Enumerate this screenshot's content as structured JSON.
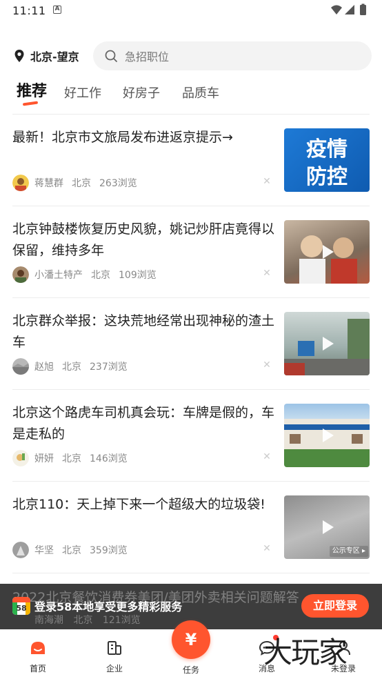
{
  "status_bar": {
    "time": "11:11",
    "indicator": "A"
  },
  "header": {
    "location": "北京-望京",
    "search_placeholder": "急招职位"
  },
  "tabs": [
    {
      "label": "推荐",
      "active": true
    },
    {
      "label": "好工作",
      "active": false
    },
    {
      "label": "好房子",
      "active": false
    },
    {
      "label": "品质车",
      "active": false
    }
  ],
  "articles": [
    {
      "title": "最新！北京市文旅局发布进返京提示→",
      "author": "蒋慧群",
      "city": "北京",
      "views": "263浏览",
      "thumb_text": "疫情\n防控",
      "video": false
    },
    {
      "title": "北京钟鼓楼恢复历史风貌，姚记炒肝店竟得以保留，维持多年",
      "author": "小潘土特产",
      "city": "北京",
      "views": "109浏览",
      "video": true
    },
    {
      "title": "北京群众举报：这块荒地经常出现神秘的渣土车",
      "author": "赵旭",
      "city": "北京",
      "views": "237浏览",
      "video": true
    },
    {
      "title": "北京这个路虎车司机真会玩：车牌是假的，车是走私的",
      "author": "妍妍",
      "city": "北京",
      "views": "146浏览",
      "video": true
    },
    {
      "title": "北京110：天上掉下来一个超级大的垃圾袋!",
      "author": "华坚",
      "city": "北京",
      "views": "359浏览",
      "video": true,
      "badge": "公示专区 ▸"
    }
  ],
  "partial_article": {
    "title": "2022北京餐饮消费券美团/美团外卖相关问题解答",
    "author": "南海潮",
    "city": "北京",
    "views": "121浏览"
  },
  "login_banner": {
    "logo_text": "58",
    "text": "登录58本地享受更多精彩服务",
    "button": "立即登录"
  },
  "bottom_nav": {
    "home": "首页",
    "company": "企业",
    "task": "任务",
    "task_symbol": "¥",
    "message": "消息",
    "profile": "未登录"
  },
  "watermark": "大玩家",
  "colors": {
    "accent": "#ff552e",
    "text": "#222222",
    "muted": "#888888"
  }
}
